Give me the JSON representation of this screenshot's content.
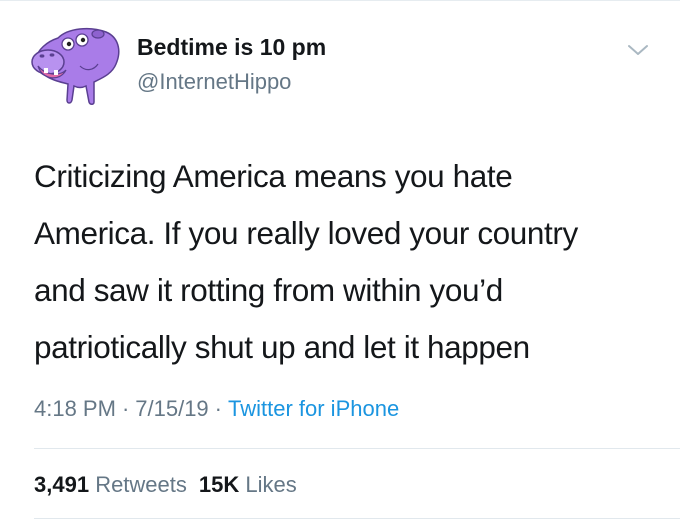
{
  "user": {
    "display_name": "Bedtime is 10 pm",
    "handle": "@InternetHippo",
    "avatar_icon": "hippo-avatar-icon"
  },
  "tweet": {
    "lines": [
      "Criticizing America means you hate",
      "America. If you really loved your country",
      "and saw it rotting from within you’d",
      "patriotically shut up and let it happen"
    ]
  },
  "meta": {
    "time": "4:18 PM",
    "separator": "·",
    "date": "7/15/19",
    "source": "Twitter for iPhone"
  },
  "stats": {
    "retweets_count": "3,491",
    "retweets_label": "Retweets",
    "likes_count": "15K",
    "likes_label": "Likes"
  },
  "colors": {
    "text": "#14171a",
    "secondary": "#657786",
    "link": "#1b95e0",
    "avatar_purple": "#a97ce8"
  }
}
